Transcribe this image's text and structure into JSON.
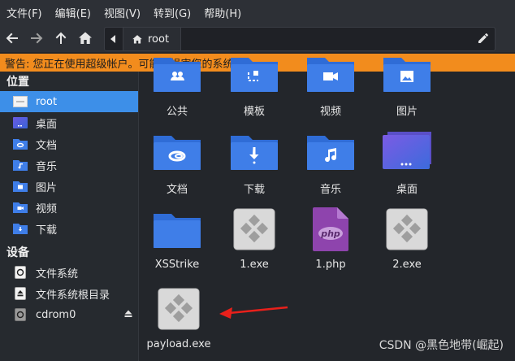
{
  "menu": [
    "文件(F)",
    "编辑(E)",
    "视图(V)",
    "转到(G)",
    "帮助(H)"
  ],
  "path": {
    "crumb": "root"
  },
  "warning": "警告: 您正在使用超级帐户。可能会损害您的系统。",
  "sidebar": {
    "places_title": "位置",
    "places": [
      {
        "label": "root",
        "icon": "home-folder-icon"
      },
      {
        "label": "桌面",
        "icon": "desktop-icon"
      },
      {
        "label": "文档",
        "icon": "documents-icon"
      },
      {
        "label": "音乐",
        "icon": "music-icon"
      },
      {
        "label": "图片",
        "icon": "pictures-icon"
      },
      {
        "label": "视频",
        "icon": "videos-icon"
      },
      {
        "label": "下载",
        "icon": "downloads-icon"
      }
    ],
    "devices_title": "设备",
    "devices": [
      {
        "label": "文件系统",
        "icon": "drive-icon"
      },
      {
        "label": "文件系统根目录",
        "icon": "root-drive-icon"
      },
      {
        "label": "cdrom0",
        "icon": "cdrom-icon"
      }
    ]
  },
  "files": [
    {
      "label": "公共",
      "icon": "public-folder-icon"
    },
    {
      "label": "模板",
      "icon": "templates-folder-icon"
    },
    {
      "label": "视频",
      "icon": "videos-folder-icon"
    },
    {
      "label": "图片",
      "icon": "pictures-folder-icon"
    },
    {
      "label": "文档",
      "icon": "documents-folder-icon"
    },
    {
      "label": "下载",
      "icon": "downloads-folder-icon"
    },
    {
      "label": "音乐",
      "icon": "music-folder-icon"
    },
    {
      "label": "桌面",
      "icon": "desktop-folder-icon"
    },
    {
      "label": "XSStrike",
      "icon": "folder-icon"
    },
    {
      "label": "1.exe",
      "icon": "executable-file-icon"
    },
    {
      "label": "1.php",
      "icon": "php-file-icon"
    },
    {
      "label": "2.exe",
      "icon": "executable-file-icon"
    },
    {
      "label": "payload.exe",
      "icon": "executable-file-icon"
    }
  ],
  "watermark": "CSDN @黑色地带(崛起)",
  "colors": {
    "accent": "#3d8fe8",
    "warning": "#f28c1d",
    "folder": "#3f7ee8",
    "php": "#8e44ad",
    "annotation_arrow": "#e8201b"
  }
}
